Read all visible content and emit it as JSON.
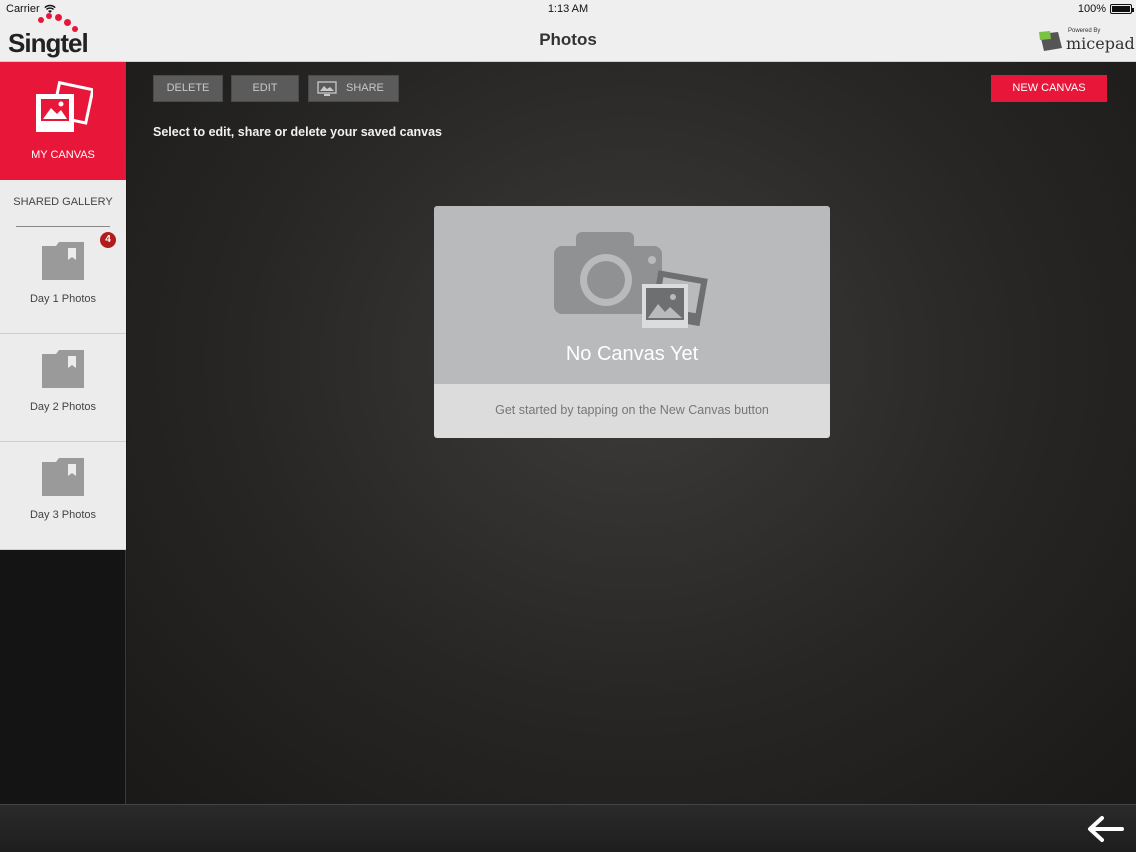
{
  "status_bar": {
    "carrier": "Carrier",
    "time": "1:13 AM",
    "battery": "100%"
  },
  "nav": {
    "title": "Photos",
    "brand": "Singtel",
    "powered_by": "Powered By",
    "powered_name": "micepad"
  },
  "sidebar": {
    "my_canvas_label": "MY CANVAS",
    "shared_gallery_label": "SHARED GALLERY",
    "items": [
      {
        "label": "Day 1 Photos",
        "badge": "4"
      },
      {
        "label": "Day 2 Photos"
      },
      {
        "label": "Day 3 Photos"
      }
    ]
  },
  "toolbar": {
    "delete_label": "DELETE",
    "edit_label": "EDIT",
    "share_label": "SHARE",
    "new_canvas_label": "NEW CANVAS"
  },
  "main": {
    "instruction": "Select to edit, share or delete your saved canvas",
    "empty_title": "No Canvas Yet",
    "empty_hint": "Get started by tapping on the New Canvas button"
  },
  "colors": {
    "accent": "#e8173a",
    "badge": "#b31c1c",
    "toolbar_button": "#5b5b5b"
  },
  "icons": [
    "wifi-icon",
    "battery-icon",
    "singtel-logo",
    "micepad-logo",
    "my-canvas-icon",
    "folder-icon",
    "share-icon",
    "camera-icon",
    "back-arrow-icon"
  ]
}
